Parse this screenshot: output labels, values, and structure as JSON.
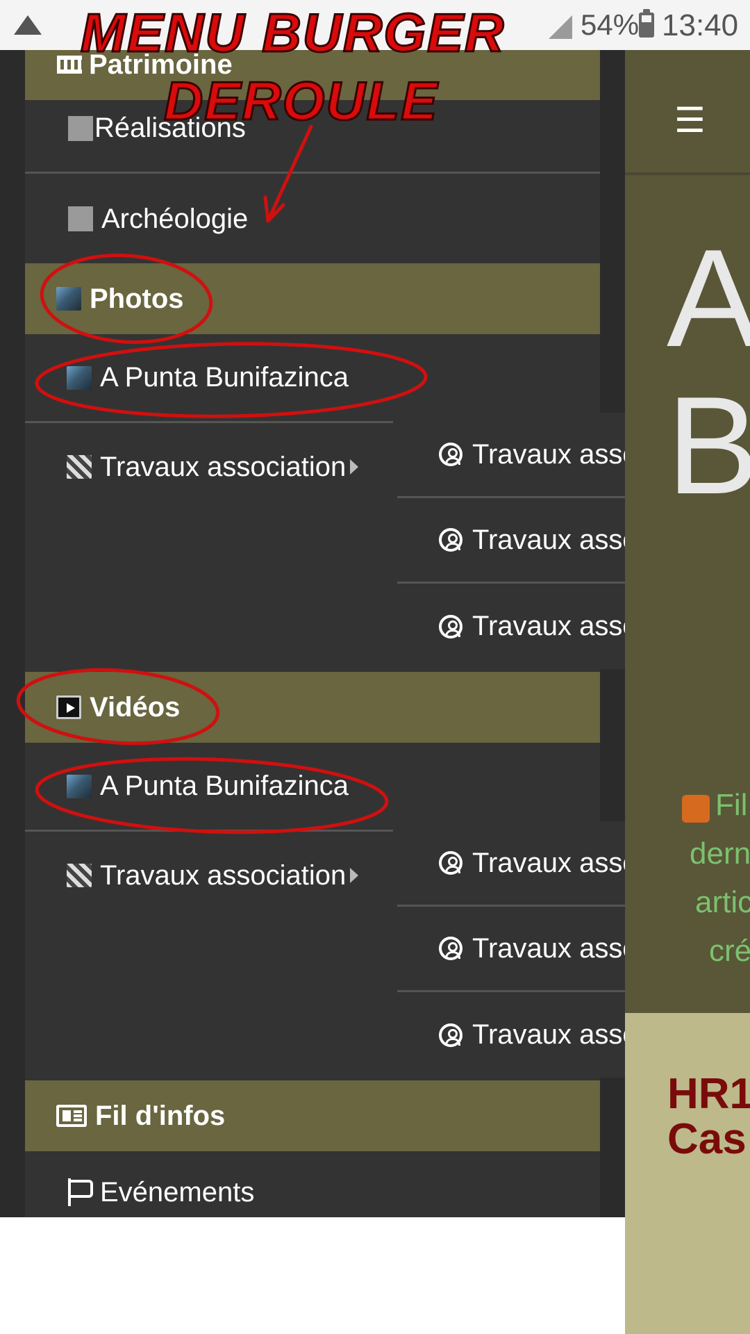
{
  "status_bar": {
    "battery": "54%",
    "time": "13:40"
  },
  "annotation": {
    "line1": "MENU BURGER",
    "line2": "DEROULE"
  },
  "menu": {
    "patrimoine": "Patrimoine",
    "realisations": "Réalisations",
    "archeologie": "Archéologie",
    "photos": "Photos",
    "photos_punta": "A Punta Bunifazinca",
    "photos_travaux": "Travaux association",
    "photos_sub": [
      "Travaux association",
      "Travaux association",
      "Travaux association"
    ],
    "videos": "Vidéos",
    "videos_punta": "A Punta Bunifazinca",
    "videos_travaux": "Travaux association",
    "videos_sub": [
      "Travaux association",
      "Travaux association",
      "Travaux association"
    ],
    "fil_infos": "Fil d'infos",
    "evenements": "Evénements"
  },
  "background_page": {
    "big_letters": [
      "A",
      "B"
    ],
    "rss_lines": [
      "Fil",
      "dern",
      "artic",
      "cré"
    ],
    "headline_lines": [
      "HR1",
      "Cas"
    ]
  },
  "colors": {
    "section_bg": "#696640",
    "drawer_bg": "#333333",
    "annotation": "#d90b0b",
    "rss_text": "#7cc16f",
    "headline": "#7a0b0b"
  }
}
